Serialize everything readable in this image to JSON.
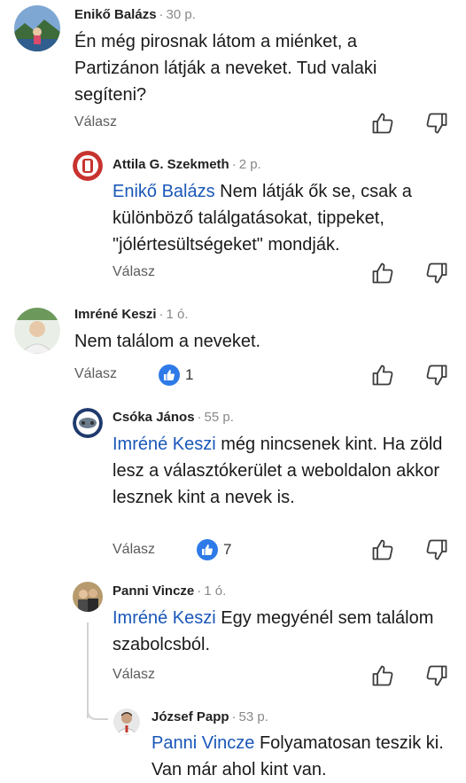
{
  "colors": {
    "mention": "#1a57b8",
    "like_badge": "#2e7ae8",
    "icon": "#3d3d3d"
  },
  "actions": {
    "reply_label": "Válasz",
    "like_icon": "thumbs-up-icon",
    "dislike_icon": "thumbs-down-icon"
  },
  "comments": [
    {
      "author": "Enikő Balázs",
      "time": "30 p.",
      "text": "Én még pirosnak látom a miénket, a Partizánon látják a neveket. Tud valaki segíteni?"
    },
    {
      "author": "Attila G. Szekmeth",
      "time": "2 p.",
      "mention": "Enikő Balázs",
      "text": " Nem látják ők se, csak a különböző találgatásokat, tippeket, \"jólértesültségeket\" mondják."
    },
    {
      "author": "Imréné Keszi",
      "time": "1 ó.",
      "text": "Nem találom a neveket.",
      "likes": "1"
    },
    {
      "author": "Csóka János",
      "time": "55 p.",
      "mention": "Imréné Keszi",
      "text": " még nincsenek kint. Ha zöld lesz a választókerület a weboldalon akkor lesznek kint a nevek is.",
      "likes": "7"
    },
    {
      "author": "Panni Vincze",
      "time": "1 ó.",
      "mention": "Imréné Keszi",
      "text": " Egy megyénél sem találom szabolcsból."
    },
    {
      "author": "József Papp",
      "time": "53 p.",
      "mention": "Panni Vincze",
      "text": " Folyamatosan teszik ki. Van már ahol kint van."
    }
  ]
}
